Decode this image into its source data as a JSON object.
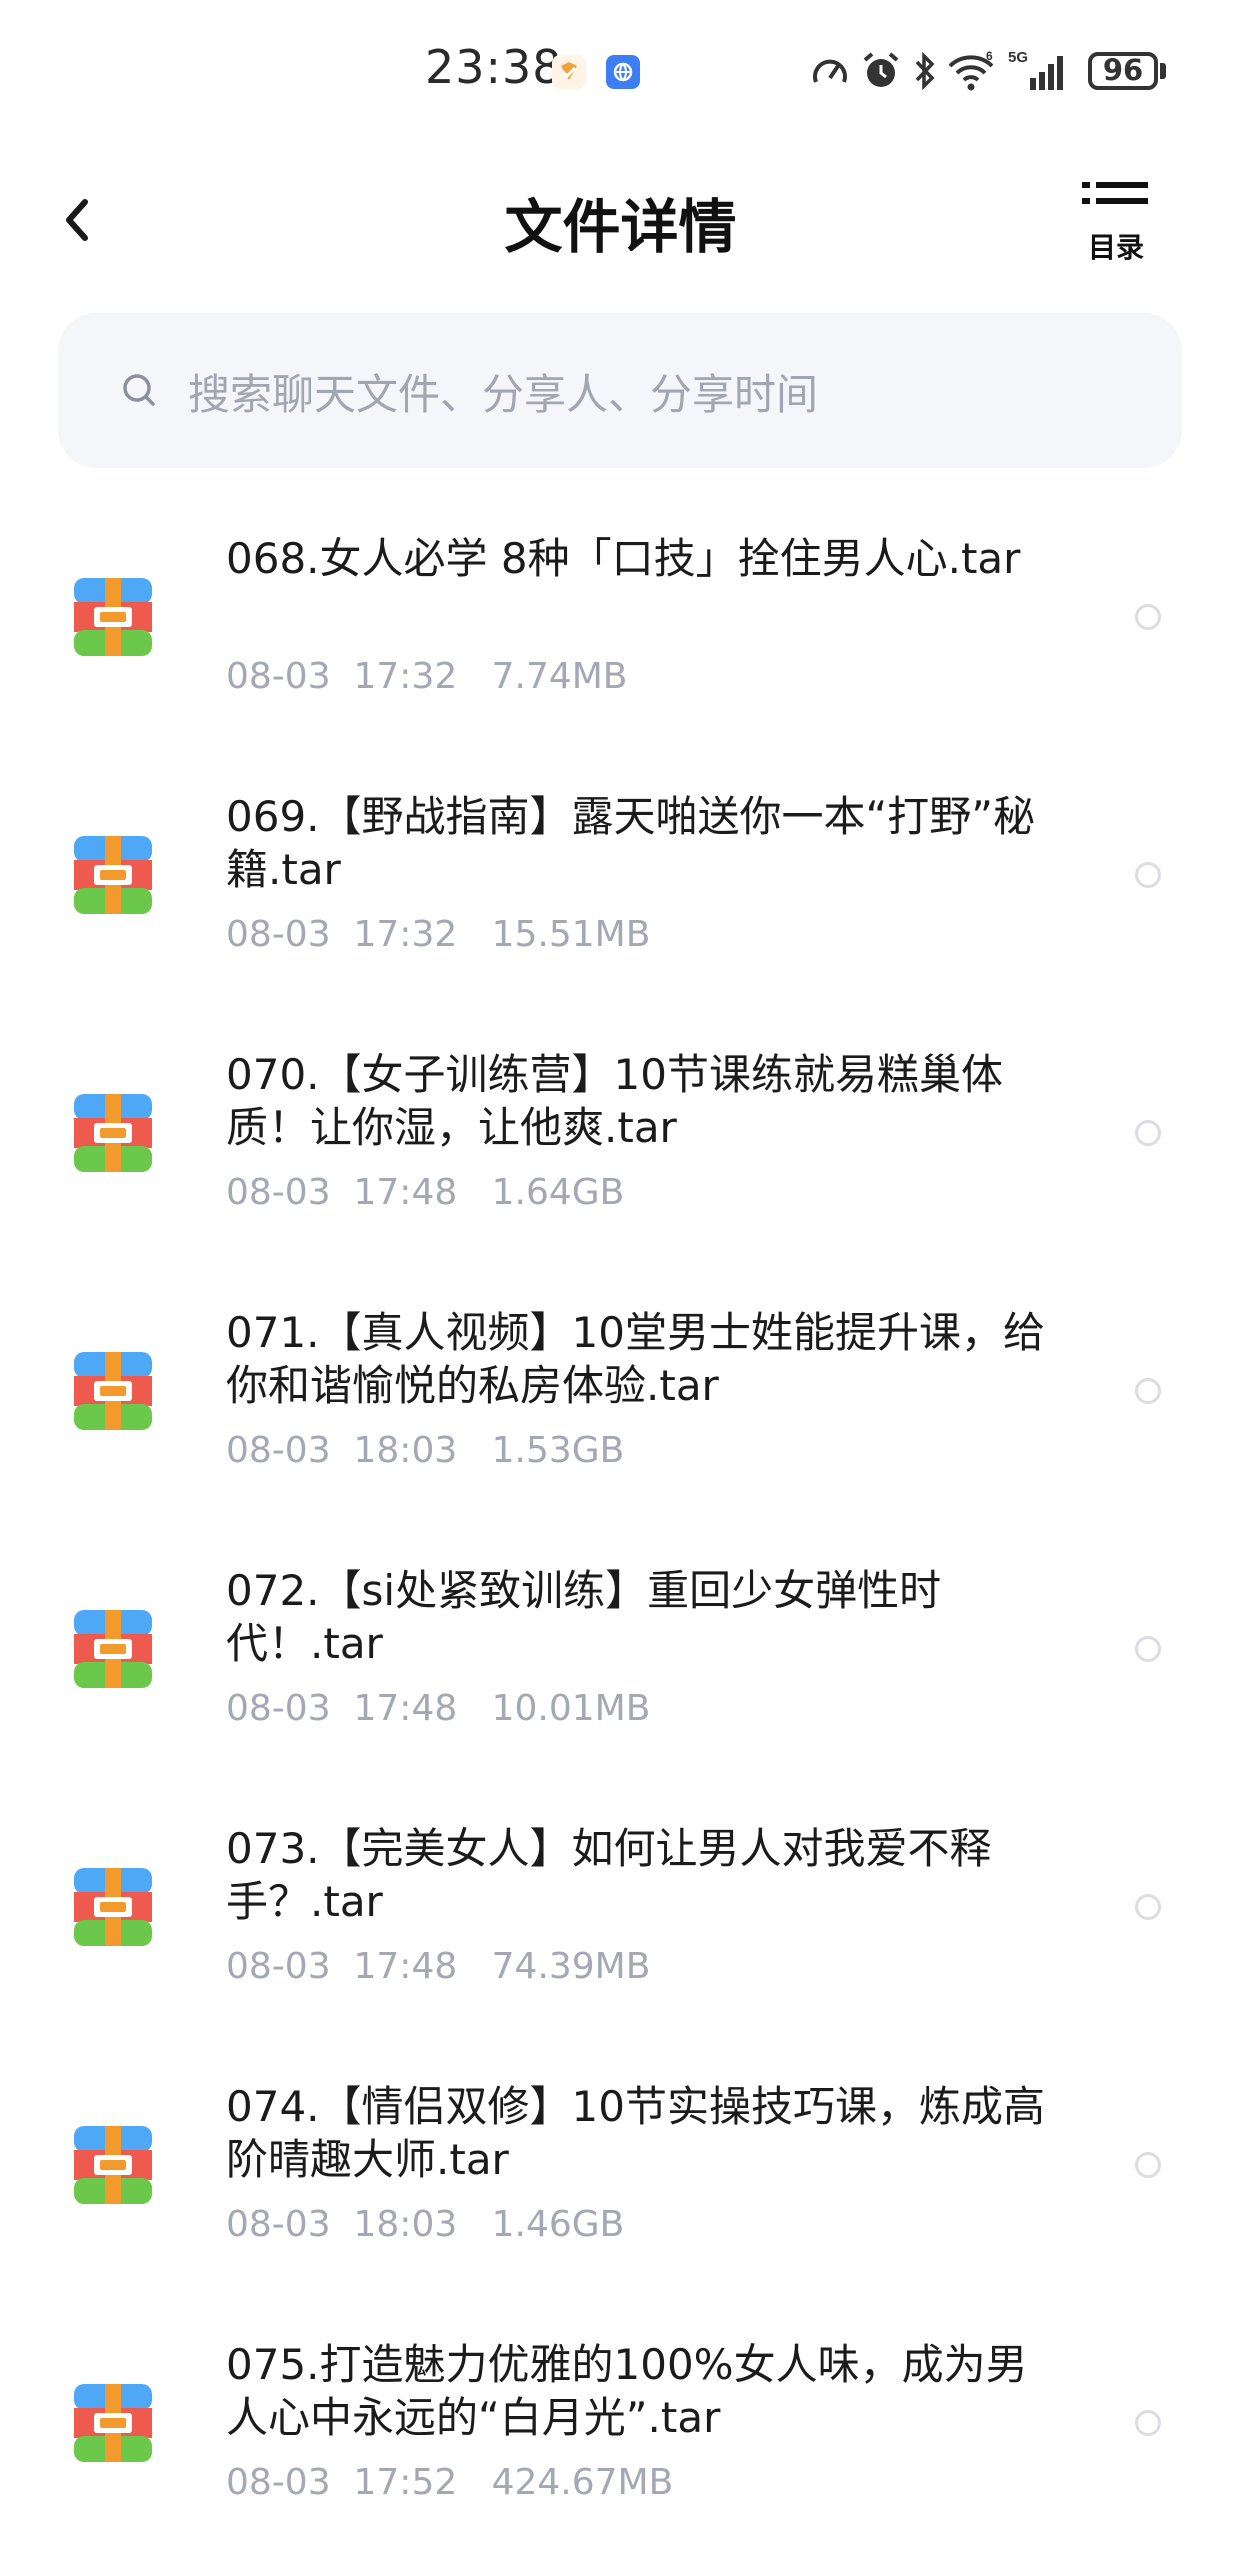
{
  "status_bar": {
    "time": "23:38",
    "battery": "96"
  },
  "header": {
    "title": "文件详情",
    "toc_label": "目录"
  },
  "search": {
    "placeholder": "搜索聊天文件、分享人、分享时间"
  },
  "files": [
    {
      "name": "068.女人必学 8种「口技」拴住男人心.tar",
      "date": "08-03",
      "time": "17:32",
      "size": "7.74MB"
    },
    {
      "name": "069.【野战指南】露天啪送你一本“打野”秘籍.tar",
      "date": "08-03",
      "time": "17:32",
      "size": "15.51MB"
    },
    {
      "name": "070.【女子训练营】10节课练就易糕巢体质！让你湿，让他爽.tar",
      "date": "08-03",
      "time": "17:48",
      "size": "1.64GB"
    },
    {
      "name": "071.【真人视频】10堂男士姓能提升课，给你和谐愉悦的私房体验.tar",
      "date": "08-03",
      "time": "18:03",
      "size": "1.53GB"
    },
    {
      "name": "072.【si处紧致训练】重回少女弹性时代！.tar",
      "date": "08-03",
      "time": "17:48",
      "size": "10.01MB"
    },
    {
      "name": "073.【完美女人】如何让男人对我爱不释手？.tar",
      "date": "08-03",
      "time": "17:48",
      "size": "74.39MB"
    },
    {
      "name": "074.【情侣双修】10节实操技巧课，炼成高阶晴趣大师.tar",
      "date": "08-03",
      "time": "18:03",
      "size": "1.46GB"
    },
    {
      "name": "075.打造魅力优雅的100%女人味，成为男人心中永远的“白月光”.tar",
      "date": "08-03",
      "time": "17:52",
      "size": "424.67MB"
    }
  ],
  "colors": {
    "archive_top": "#4fa8f5",
    "archive_mid": "#ef5a4e",
    "archive_bottom": "#6cc84a",
    "archive_band": "#f39a2d"
  }
}
